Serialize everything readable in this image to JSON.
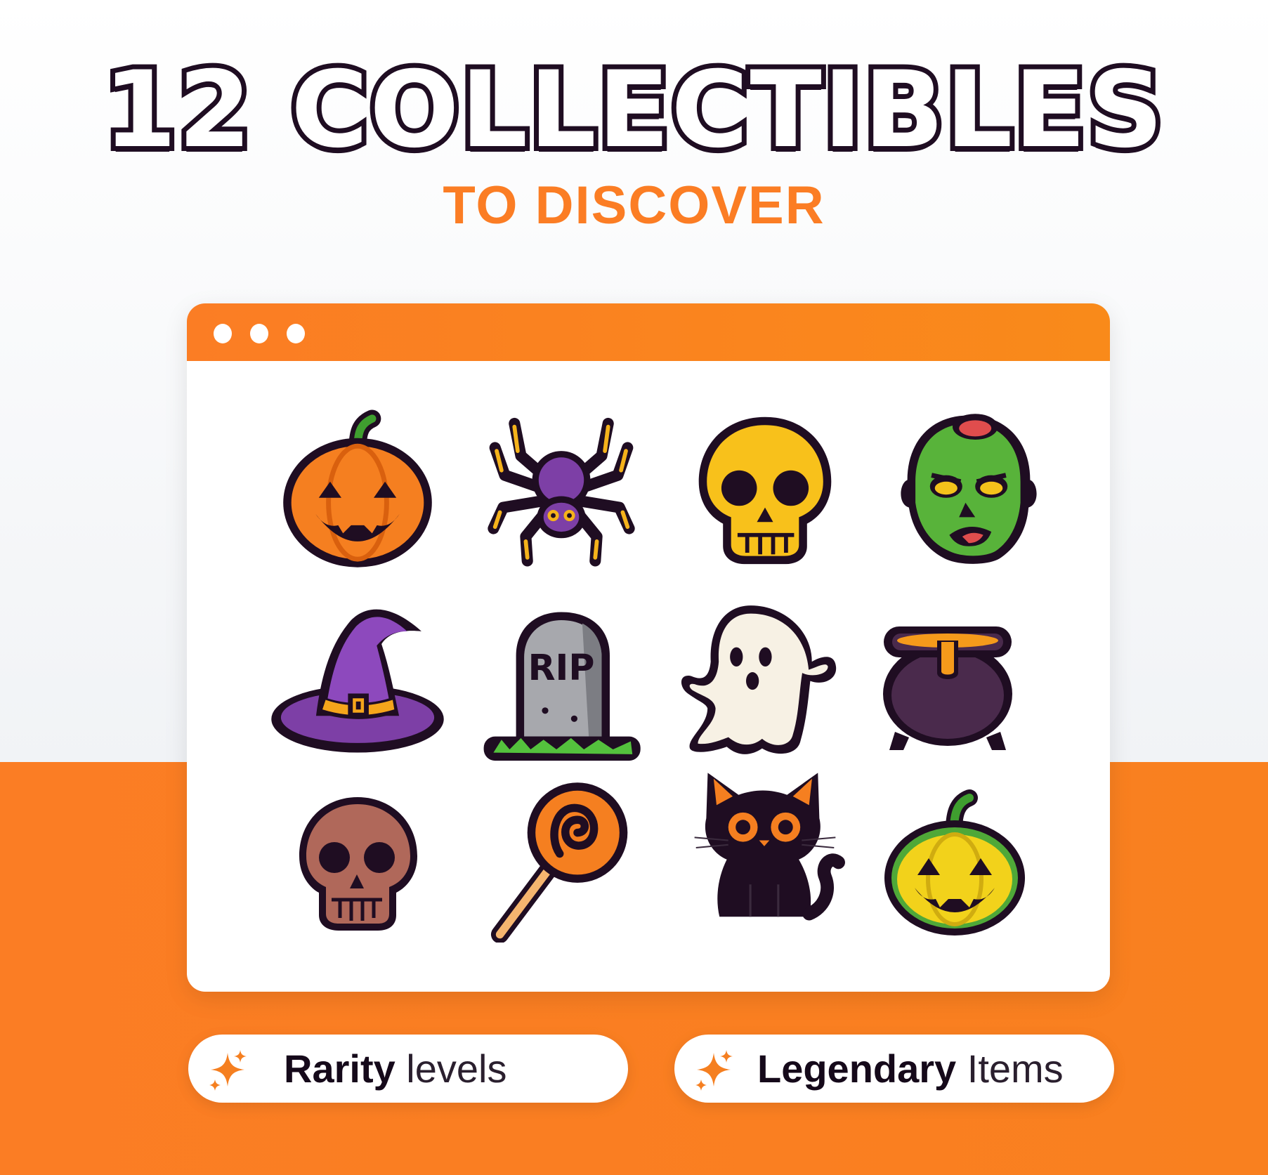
{
  "headline": "12 COLLECTIBLES",
  "subheadline": "TO DISCOVER",
  "window": {
    "titlebar_color": "#fb7d24",
    "controls": [
      "window-dot",
      "window-dot",
      "window-dot"
    ],
    "grid_items": [
      {
        "icon": "jack-o-lantern-orange-icon"
      },
      {
        "icon": "purple-spider-icon"
      },
      {
        "icon": "yellow-skull-icon"
      },
      {
        "icon": "zombie-head-icon"
      },
      {
        "icon": "witch-hat-icon"
      },
      {
        "icon": "tombstone-icon",
        "text": "RIP"
      },
      {
        "icon": "ghost-icon"
      },
      {
        "icon": "cauldron-icon"
      },
      {
        "icon": "brown-skull-icon"
      },
      {
        "icon": "swirl-lollipop-icon"
      },
      {
        "icon": "black-cat-icon"
      },
      {
        "icon": "jack-o-lantern-yellow-icon"
      }
    ]
  },
  "badges": [
    {
      "bold": "Rarity",
      "light": " levels",
      "icon": "sparkle-icon"
    },
    {
      "bold": "Legendary",
      "light": " Items",
      "icon": "sparkle-icon"
    }
  ],
  "colors": {
    "accent": "#fb7d24",
    "outline": "#1f0d22",
    "background_top": "#f4f5f8"
  }
}
